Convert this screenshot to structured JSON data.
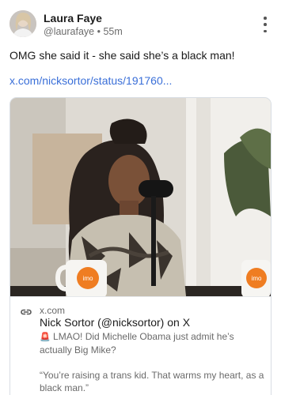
{
  "author": {
    "name": "Laura Faye",
    "handle": "@laurafaye",
    "separator": "•",
    "time_ago": "55m"
  },
  "post": {
    "text": "OMG she said it - she said she’s a black man!",
    "link_text": "x.com/nicksortor/status/191760..."
  },
  "link_card": {
    "domain": "x.com",
    "title": "Nick Sortor (@nicksortor) on X",
    "emoji": "🚨",
    "description_1": "LMAO! Did Michelle Obama just admit he’s actually Big Mike?",
    "description_2": "“You’re raising a trans kid. That warms my heart, as a black man.”",
    "mug_text": "imo"
  },
  "icons": {
    "more": "more-vertical-icon",
    "link": "link-icon",
    "siren": "siren-emoji-icon"
  },
  "colors": {
    "link": "#3a6fd8",
    "muted": "#6a6a6a",
    "card_border": "#d8dde3",
    "mug_logo": "#ef7d22"
  }
}
